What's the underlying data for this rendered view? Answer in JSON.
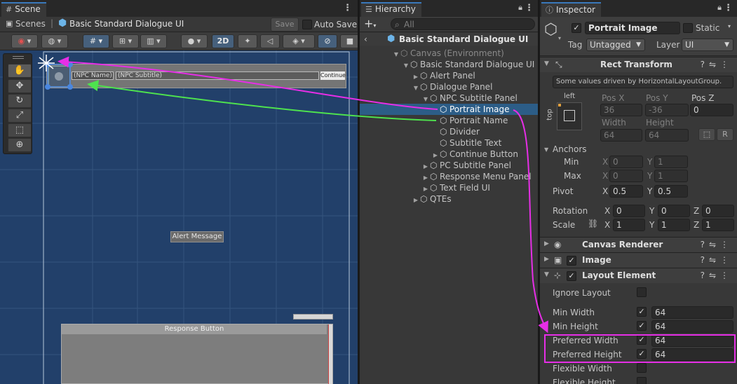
{
  "scene": {
    "tab_title": "Scene",
    "breadcrumb_root": "Scenes",
    "breadcrumb_current": "Basic Standard Dialogue UI",
    "save_label": "Save",
    "auto_save_label": "Auto Save",
    "mode_2d_label": "2D",
    "canvas": {
      "npc_name": "(NPC Name)",
      "npc_subtitle": "(NPC Subtitle)",
      "continue_label": "Continue",
      "alert_message": "Alert Message",
      "response_button": "Response Button"
    }
  },
  "hierarchy": {
    "tab_title": "Hierarchy",
    "search_placeholder": "All",
    "root": "Basic Standard Dialogue UI",
    "items": [
      {
        "label": "Canvas (Environment)"
      },
      {
        "label": "Basic Standard Dialogue UI"
      },
      {
        "label": "Alert Panel"
      },
      {
        "label": "Dialogue Panel"
      },
      {
        "label": "NPC Subtitle Panel"
      },
      {
        "label": "Portrait Image"
      },
      {
        "label": "Portrait Name"
      },
      {
        "label": "Divider"
      },
      {
        "label": "Subtitle Text"
      },
      {
        "label": "Continue Button"
      },
      {
        "label": "PC Subtitle Panel"
      },
      {
        "label": "Response Menu Panel"
      },
      {
        "label": "Text Field UI"
      },
      {
        "label": "QTEs"
      }
    ]
  },
  "inspector": {
    "tab_title": "Inspector",
    "object_name": "Portrait Image",
    "static_label": "Static",
    "tag_label": "Tag",
    "tag_value": "Untagged",
    "layer_label": "Layer",
    "layer_value": "UI",
    "rect_transform": {
      "title": "Rect Transform",
      "note": "Some values driven by HorizontalLayoutGroup.",
      "anchor_h": "left",
      "anchor_v": "top",
      "pos_x_label": "Pos X",
      "pos_x": "36",
      "pos_y_label": "Pos Y",
      "pos_y": "-36",
      "pos_z_label": "Pos Z",
      "pos_z": "0",
      "width_label": "Width",
      "width": "64",
      "height_label": "Height",
      "height": "64",
      "r_label": "R",
      "anchors_label": "Anchors",
      "min_label": "Min",
      "min_x": "0",
      "min_y": "1",
      "max_label": "Max",
      "max_x": "0",
      "max_y": "1",
      "pivot_label": "Pivot",
      "pivot_x": "0.5",
      "pivot_y": "0.5",
      "rotation_label": "Rotation",
      "rot_x": "0",
      "rot_y": "0",
      "rot_z": "0",
      "scale_label": "Scale",
      "scale_x": "1",
      "scale_y": "1",
      "scale_z": "1",
      "x": "X",
      "y": "Y",
      "z": "Z"
    },
    "canvas_renderer": "Canvas Renderer",
    "image": "Image",
    "layout_element": {
      "title": "Layout Element",
      "ignore_layout": "Ignore Layout",
      "min_width": "Min Width",
      "min_width_value": "64",
      "min_height": "Min Height",
      "min_height_value": "64",
      "preferred_width": "Preferred Width",
      "preferred_width_value": "64",
      "preferred_height": "Preferred Height",
      "preferred_height_value": "64",
      "flexible_width": "Flexible Width",
      "flexible_height": "Flexible Height"
    }
  },
  "colors": {
    "annotation_magenta": "#e62ee6",
    "annotation_green": "#4ee24e",
    "selection": "#2c5d87",
    "scene_bg": "#22406a"
  }
}
